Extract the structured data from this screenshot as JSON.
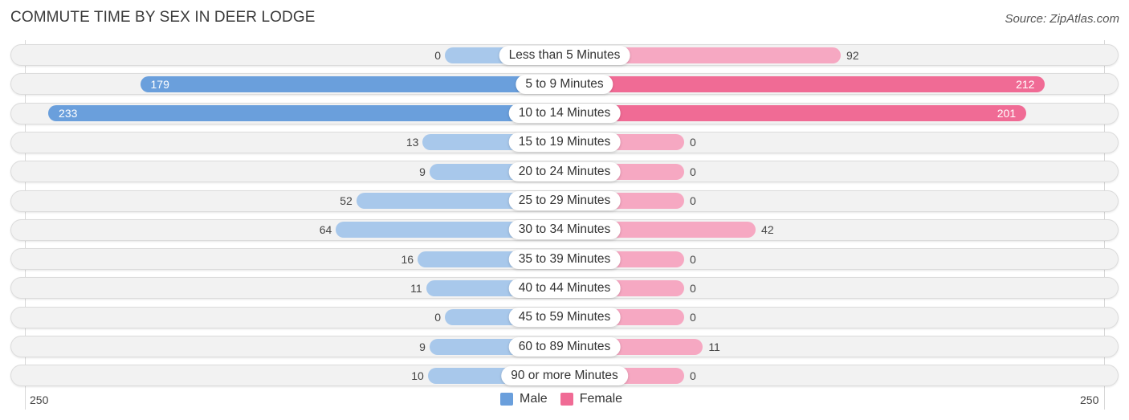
{
  "title": "COMMUTE TIME BY SEX IN DEER LODGE",
  "source": "Source: ZipAtlas.com",
  "colors": {
    "male": "#6a9fdc",
    "male_light": "#a8c8eb",
    "female": "#f06b95",
    "female_light": "#f6a8c2"
  },
  "chart_data": {
    "type": "bar",
    "orientation": "horizontal-diverging",
    "title": "COMMUTE TIME BY SEX IN DEER LODGE",
    "categories": [
      "Less than 5 Minutes",
      "5 to 9 Minutes",
      "10 to 14 Minutes",
      "15 to 19 Minutes",
      "20 to 24 Minutes",
      "25 to 29 Minutes",
      "30 to 34 Minutes",
      "35 to 39 Minutes",
      "40 to 44 Minutes",
      "45 to 59 Minutes",
      "60 to 89 Minutes",
      "90 or more Minutes"
    ],
    "series": [
      {
        "name": "Male",
        "values": [
          0,
          179,
          233,
          13,
          9,
          52,
          64,
          16,
          11,
          0,
          9,
          10
        ]
      },
      {
        "name": "Female",
        "values": [
          92,
          212,
          201,
          0,
          0,
          0,
          42,
          0,
          0,
          0,
          11,
          0
        ]
      }
    ],
    "axis": {
      "left_label": "250",
      "right_label": "250",
      "range": [
        250,
        250
      ]
    },
    "legend": {
      "position": "bottom-center",
      "items": [
        "Male",
        "Female"
      ]
    },
    "grid": false
  }
}
